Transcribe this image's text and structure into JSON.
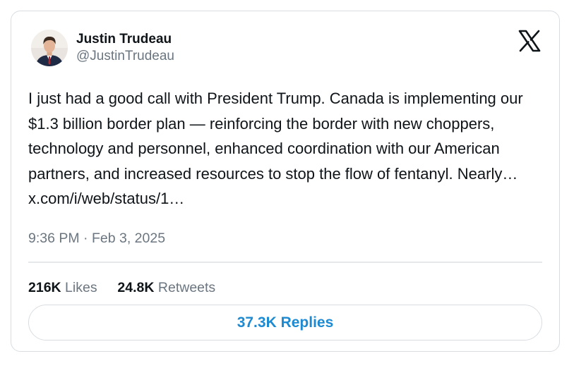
{
  "author": {
    "name": "Justin Trudeau",
    "handle": "@JustinTrudeau",
    "avatar_icon": "profile-photo"
  },
  "brand": {
    "logo_icon": "x-logo-icon",
    "text_color": "#0f1419",
    "muted_color": "#6b7680",
    "accent_color": "#1d8ad1",
    "border_color": "#d9dde1"
  },
  "tweet": {
    "text": "I just had a good call with President Trump. Canada is implementing our $1.3 billion border plan — reinforcing the border with new choppers, technology and personnel, enhanced coordination with our American partners, and increased resources to stop the flow of fentanyl. Nearly…",
    "link": "x.com/i/web/status/1…"
  },
  "meta": {
    "time": "9:36 PM",
    "separator": "·",
    "date": "Feb 3, 2025"
  },
  "stats": {
    "likes_count": "216K",
    "likes_label": "Likes",
    "retweets_count": "24.8K",
    "retweets_label": "Retweets"
  },
  "replies_button": {
    "label": "37.3K Replies"
  }
}
